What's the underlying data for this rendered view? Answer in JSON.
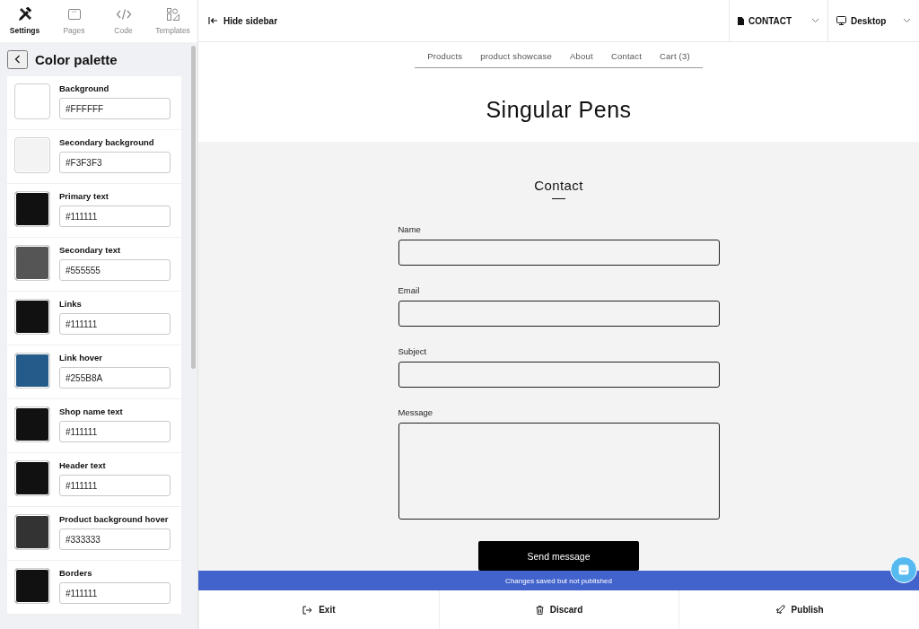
{
  "sidebar_tabs": [
    {
      "label": "Settings",
      "kind": "settings",
      "selected": true
    },
    {
      "label": "Pages",
      "kind": "pages",
      "selected": false
    },
    {
      "label": "Code",
      "kind": "code",
      "selected": false
    },
    {
      "label": "Templates",
      "kind": "templates",
      "selected": false
    }
  ],
  "panel": {
    "title": "Color palette"
  },
  "colors": [
    {
      "label": "Background",
      "value": "#FFFFFF",
      "color": "#ffffff"
    },
    {
      "label": "Secondary background",
      "value": "#F3F3F3",
      "color": "#f3f3f3"
    },
    {
      "label": "Primary text",
      "value": "#111111",
      "color": "#111111"
    },
    {
      "label": "Secondary text",
      "value": "#555555",
      "color": "#555555"
    },
    {
      "label": "Links",
      "value": "#111111",
      "color": "#111111"
    },
    {
      "label": "Link hover",
      "value": "#255B8A",
      "color": "#255b8a"
    },
    {
      "label": "Shop name text",
      "value": "#111111",
      "color": "#111111"
    },
    {
      "label": "Header text",
      "value": "#111111",
      "color": "#111111"
    },
    {
      "label": "Product background hover",
      "value": "#333333",
      "color": "#333333"
    },
    {
      "label": "Borders",
      "value": "#111111",
      "color": "#111111"
    }
  ],
  "toolbar": {
    "hide_sidebar": "Hide sidebar",
    "page_select": "CONTACT",
    "device_select": "Desktop"
  },
  "site": {
    "nav": [
      "Products",
      "product showcase",
      "About",
      "Contact",
      "Cart (3)"
    ],
    "shop_name": "Singular Pens",
    "heading": "Contact",
    "fields": [
      {
        "label": "Name",
        "kind": "input"
      },
      {
        "label": "Email",
        "kind": "input"
      },
      {
        "label": "Subject",
        "kind": "input"
      },
      {
        "label": "Message",
        "kind": "textarea"
      }
    ],
    "submit": "Send message"
  },
  "status": "Changes saved but not published",
  "actions": [
    {
      "label": "Exit",
      "kind": "exit"
    },
    {
      "label": "Discard",
      "kind": "discard"
    },
    {
      "label": "Publish",
      "kind": "publish"
    }
  ]
}
